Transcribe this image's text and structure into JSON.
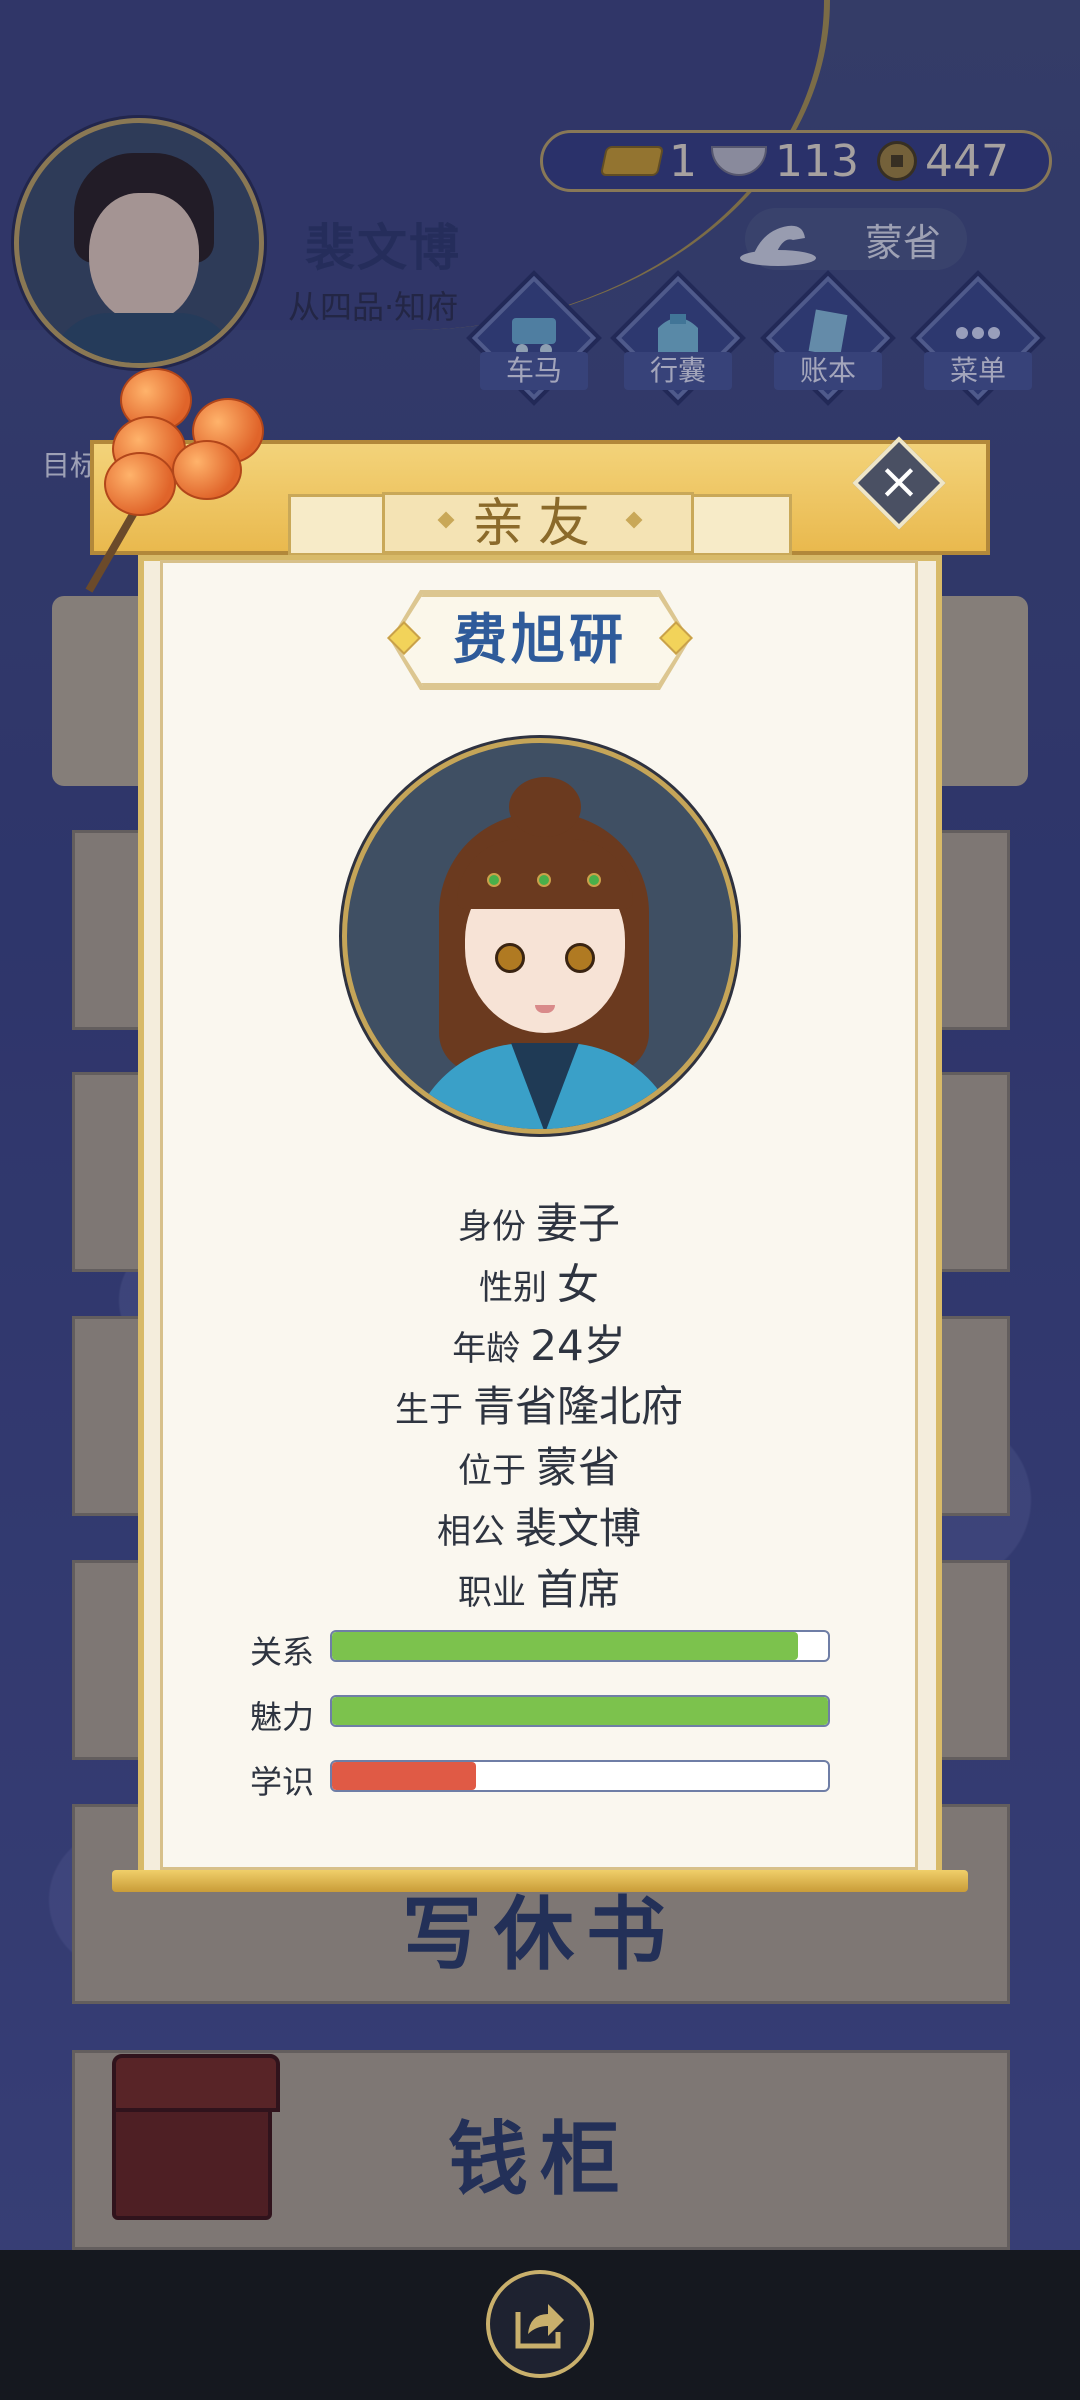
{
  "player": {
    "name": "裴文博",
    "rank": "从四品·知府"
  },
  "currency": {
    "gold": "1",
    "silver": "113",
    "copper": "447"
  },
  "location": "蒙省",
  "menu": [
    {
      "label": "车马",
      "icon": "carriage-icon"
    },
    {
      "label": "行囊",
      "icon": "bag-icon"
    },
    {
      "label": "账本",
      "icon": "ledger-icon"
    },
    {
      "label": "菜单",
      "icon": "more-icon"
    }
  ],
  "goal_label": "目标",
  "background_cards": {
    "writing_title": "写休书",
    "cabinet_title": "钱柜"
  },
  "dialog": {
    "title": "亲友",
    "name": "费旭研",
    "info": [
      {
        "key": "身份",
        "value": "妻子"
      },
      {
        "key": "性别",
        "value": "女"
      },
      {
        "key": "年龄",
        "value": "24岁"
      },
      {
        "key": "生于",
        "value": "青省隆北府"
      },
      {
        "key": "位于",
        "value": "蒙省"
      },
      {
        "key": "相公",
        "value": "裴文博"
      },
      {
        "key": "职业",
        "value": "首席"
      }
    ],
    "stats": [
      {
        "label": "关系",
        "value": 0.94,
        "color": "#7cc24d"
      },
      {
        "label": "魅力",
        "value": 1.0,
        "color": "#7cc24d"
      },
      {
        "label": "学识",
        "value": 0.29,
        "color": "#e05a45"
      }
    ]
  },
  "colors": {
    "accent_gold": "#d8ba68",
    "title_blue": "#2f5b9a",
    "bar_green": "#7cc24d",
    "bar_red": "#e05a45"
  }
}
